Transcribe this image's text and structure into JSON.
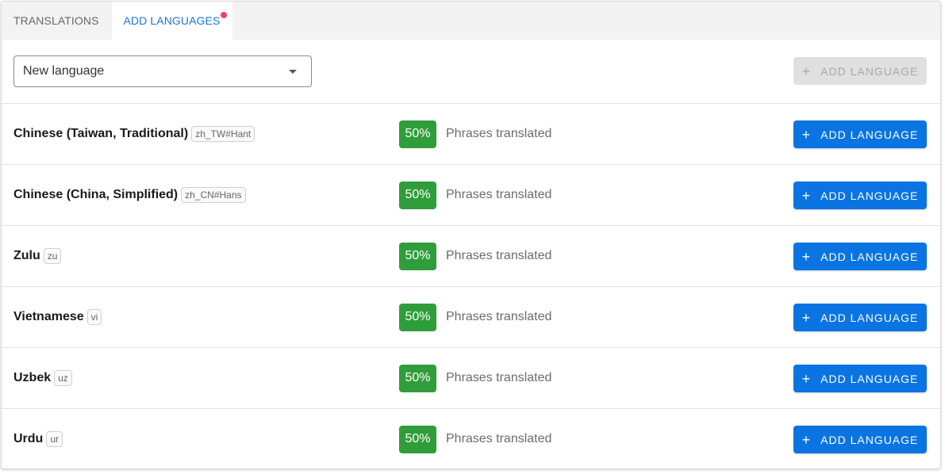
{
  "tabs": [
    {
      "label": "TRANSLATIONS",
      "active": false
    },
    {
      "label": "ADD LANGUAGES",
      "active": true,
      "notification": true
    }
  ],
  "add_bar": {
    "select_value": "New language",
    "button_label": "ADD LANGUAGE",
    "button_disabled": true
  },
  "rows": [
    {
      "name": "Chinese (Taiwan, Traditional)",
      "code": "zh_TW#Hant",
      "percent": "50%",
      "status": "Phrases translated",
      "button": "ADD LANGUAGE"
    },
    {
      "name": "Chinese (China, Simplified)",
      "code": "zh_CN#Hans",
      "percent": "50%",
      "status": "Phrases translated",
      "button": "ADD LANGUAGE"
    },
    {
      "name": "Zulu",
      "code": "zu",
      "percent": "50%",
      "status": "Phrases translated",
      "button": "ADD LANGUAGE"
    },
    {
      "name": "Vietnamese",
      "code": "vi",
      "percent": "50%",
      "status": "Phrases translated",
      "button": "ADD LANGUAGE"
    },
    {
      "name": "Uzbek",
      "code": "uz",
      "percent": "50%",
      "status": "Phrases translated",
      "button": "ADD LANGUAGE"
    },
    {
      "name": "Urdu",
      "code": "ur",
      "percent": "50%",
      "status": "Phrases translated",
      "button": "ADD LANGUAGE"
    }
  ],
  "colors": {
    "accent": "#0a74e2",
    "tab_active": "#1976d2",
    "badge_green": "#2f9e3a",
    "notification_dot": "#f44357",
    "disabled_bg": "#e0e0e0"
  },
  "icons": {
    "dropdown": "caret-down-icon",
    "add": "plus-icon"
  }
}
